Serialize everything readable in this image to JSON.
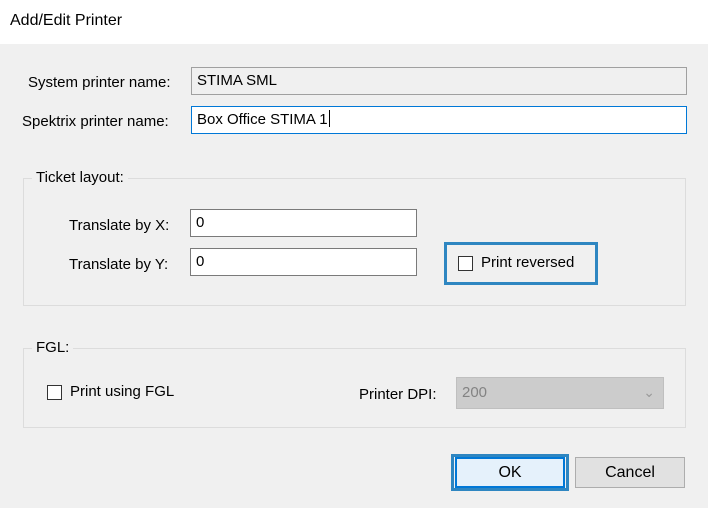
{
  "window": {
    "title": "Add/Edit Printer"
  },
  "system_printer": {
    "label": "System printer name:",
    "value": "STIMA SML"
  },
  "spektrix_printer": {
    "label": "Spektrix printer name:",
    "value": "Box Office STIMA 1"
  },
  "ticket_layout": {
    "legend": "Ticket layout:",
    "translate_x_label": "Translate by X:",
    "translate_x_value": "0",
    "translate_y_label": "Translate by Y:",
    "translate_y_value": "0",
    "print_reversed_label": "Print reversed",
    "print_reversed_checked": false
  },
  "fgl": {
    "legend": "FGL:",
    "print_using_fgl_label": "Print using FGL",
    "print_using_fgl_checked": false,
    "printer_dpi_label": "Printer DPI:",
    "printer_dpi_value": "200"
  },
  "buttons": {
    "ok": "OK",
    "cancel": "Cancel"
  },
  "colors": {
    "highlight": "#2e86c1",
    "focus": "#0078d7"
  },
  "icons": {
    "dropdown": "chevron-down-icon"
  }
}
